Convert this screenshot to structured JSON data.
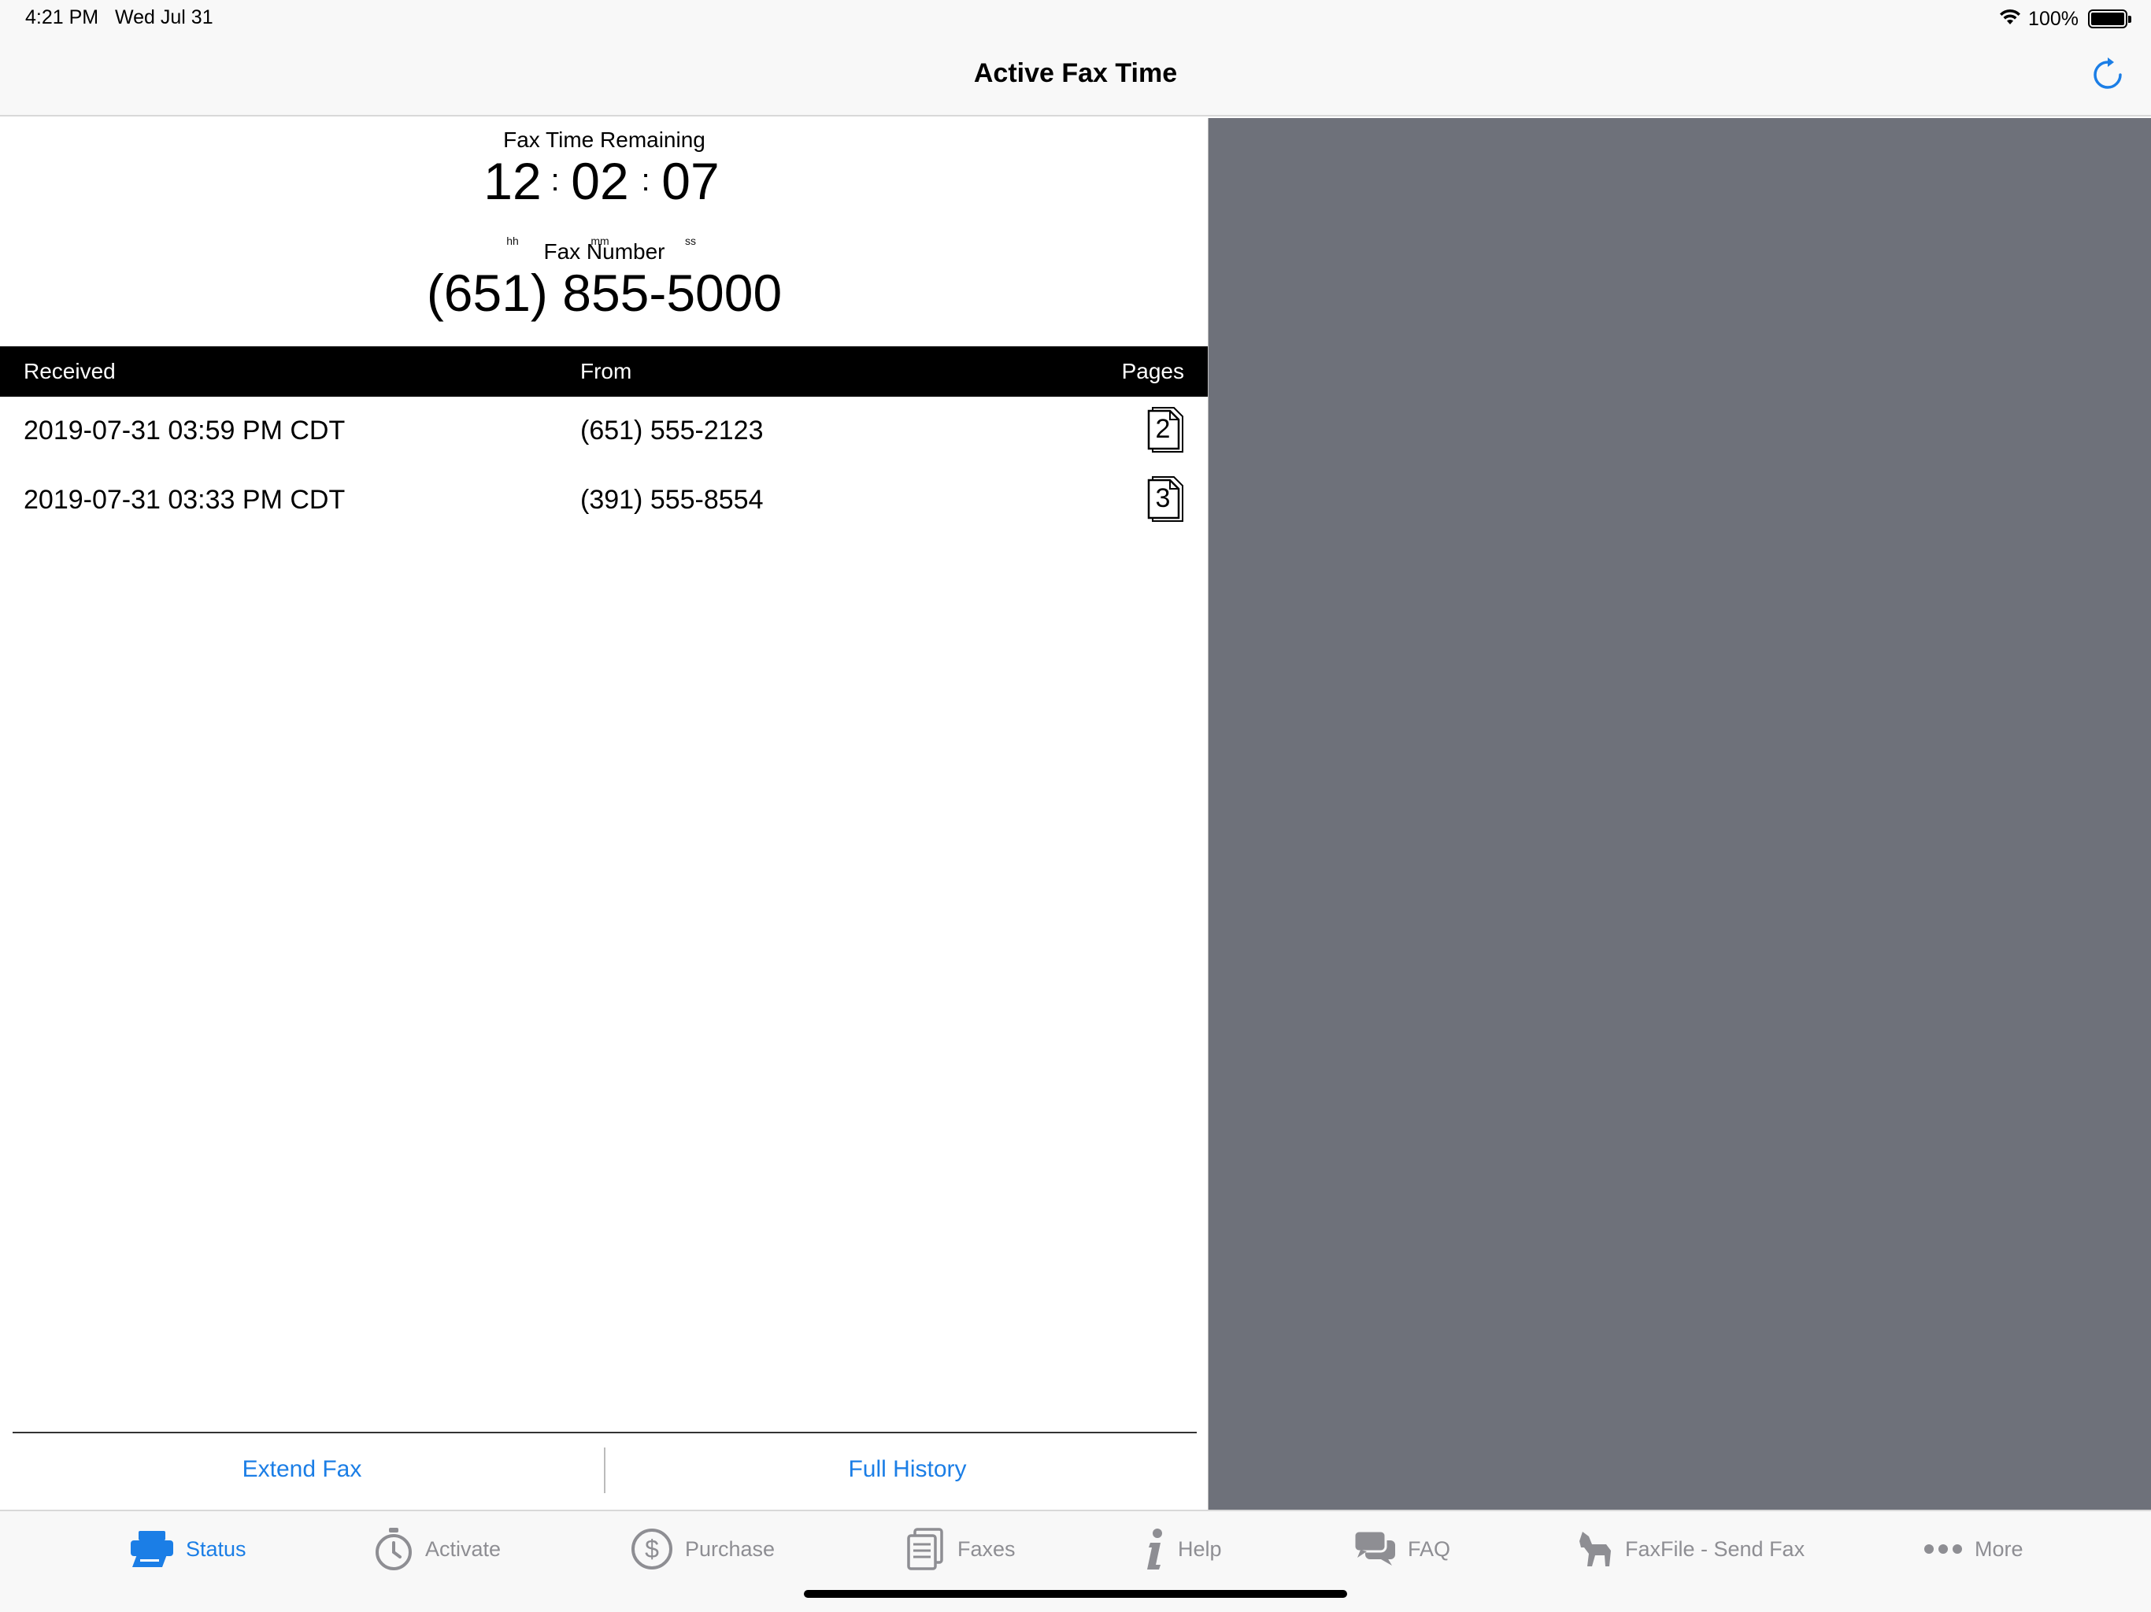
{
  "status_bar": {
    "time": "4:21 PM",
    "date": "Wed Jul 31",
    "battery": "100%"
  },
  "nav": {
    "title": "Active Fax Time",
    "refresh_icon": "refresh-icon"
  },
  "timer": {
    "label": "Fax Time Remaining",
    "hours": "12",
    "minutes": "02",
    "seconds": "07",
    "hours_unit": "hh",
    "minutes_unit": "mm",
    "seconds_unit": "ss",
    "separator": ":"
  },
  "fax_number": {
    "label": "Fax Number",
    "value": "(651) 855-5000"
  },
  "table": {
    "headers": {
      "received": "Received",
      "from": "From",
      "pages": "Pages"
    },
    "rows": [
      {
        "received": "2019-07-31 03:59 PM CDT",
        "from": "(651) 555-2123",
        "pages": "2"
      },
      {
        "received": "2019-07-31 03:33 PM CDT",
        "from": "(391) 555-8554",
        "pages": "3"
      }
    ]
  },
  "actions": {
    "extend": "Extend Fax",
    "history": "Full History"
  },
  "tabs": [
    {
      "label": "Status",
      "icon": "printer-icon",
      "active": true
    },
    {
      "label": "Activate",
      "icon": "stopwatch-icon",
      "active": false
    },
    {
      "label": "Purchase",
      "icon": "dollar-coin-icon",
      "active": false
    },
    {
      "label": "Faxes",
      "icon": "document-stack-icon",
      "active": false
    },
    {
      "label": "Help",
      "icon": "info-icon",
      "active": false
    },
    {
      "label": "FAQ",
      "icon": "chat-bubbles-icon",
      "active": false
    },
    {
      "label": "FaxFile - Send Fax",
      "icon": "dog-icon",
      "active": false
    },
    {
      "label": "More",
      "icon": "more-dots-icon",
      "active": false
    }
  ],
  "colors": {
    "accent": "#1b7ee6",
    "detail_background": "#6e717a",
    "table_header": "#000000",
    "inactive_tab": "#8e8e93"
  }
}
